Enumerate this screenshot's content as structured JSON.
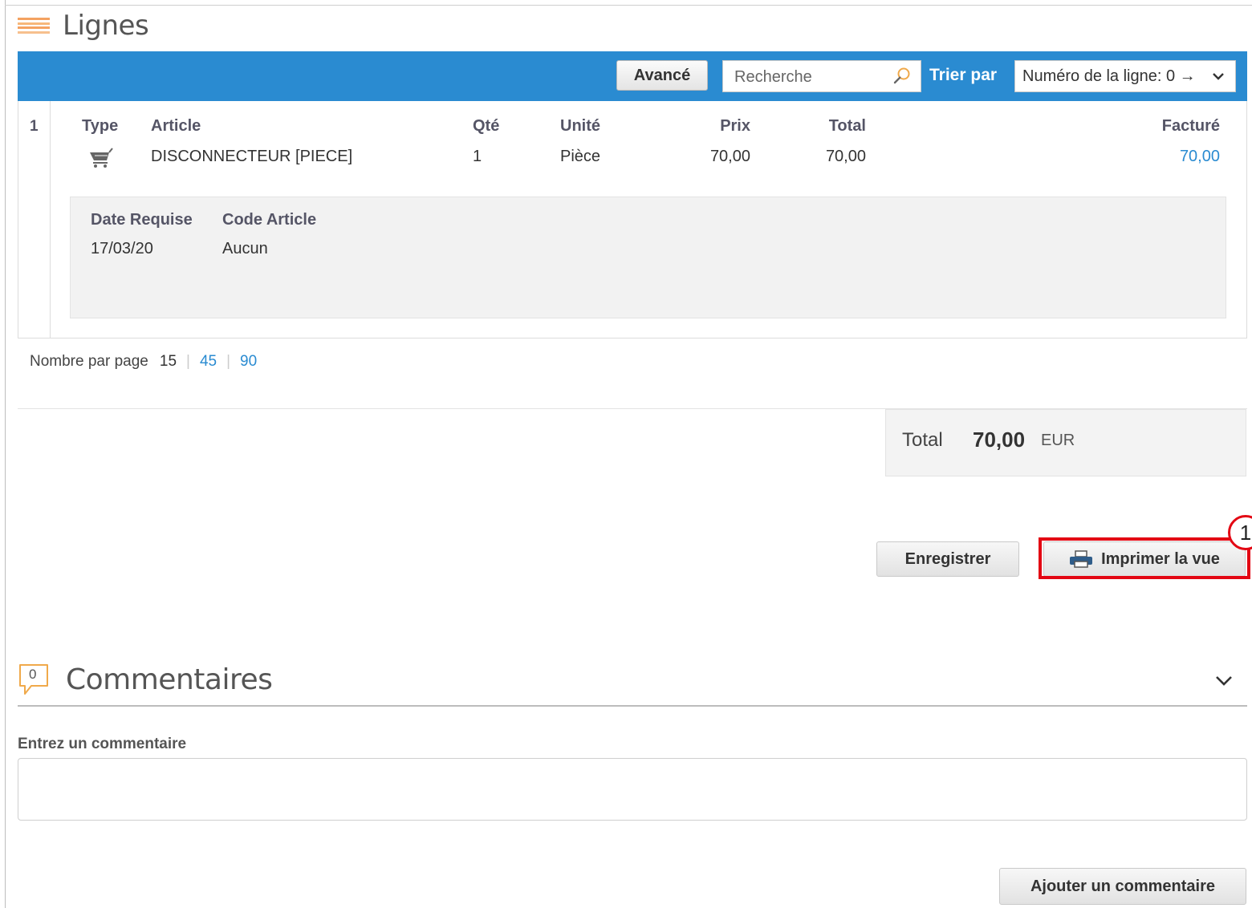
{
  "lines_section": {
    "title": "Lignes"
  },
  "toolbar": {
    "advanced_label": "Avancé",
    "search_placeholder": "Recherche",
    "sort_label": "Trier par",
    "sort_value": "Numéro de la ligne: 0 →"
  },
  "table": {
    "columns": {
      "type": "Type",
      "article": "Article",
      "qty": "Qté",
      "unit": "Unité",
      "price": "Prix",
      "total": "Total",
      "invoiced": "Facturé"
    },
    "rows": [
      {
        "line_no": "1",
        "type_icon": "shopping-cart-icon",
        "article": "DISCONNECTEUR [PIECE]",
        "qty": "1",
        "unit": "Pièce",
        "price": "70,00",
        "total": "70,00",
        "invoiced": "70,00",
        "details": {
          "date_label": "Date Requise",
          "date_value": "17/03/20",
          "code_label": "Code Article",
          "code_value": "Aucun"
        }
      }
    ]
  },
  "pagination": {
    "label": "Nombre par page",
    "current": "15",
    "options": [
      "45",
      "90"
    ]
  },
  "totals": {
    "label": "Total",
    "value": "70,00",
    "currency": "EUR"
  },
  "actions": {
    "save_label": "Enregistrer",
    "print_label": "Imprimer la vue",
    "step_number": "1"
  },
  "comments": {
    "count": "0",
    "title": "Commentaires",
    "input_label": "Entrez un commentaire",
    "add_label": "Ajouter un commentaire"
  },
  "colors": {
    "toolbar_blue": "#2a8bd1",
    "link_blue": "#2a8bd1",
    "highlight_red": "#e30613",
    "icon_orange": "#f4a261"
  }
}
